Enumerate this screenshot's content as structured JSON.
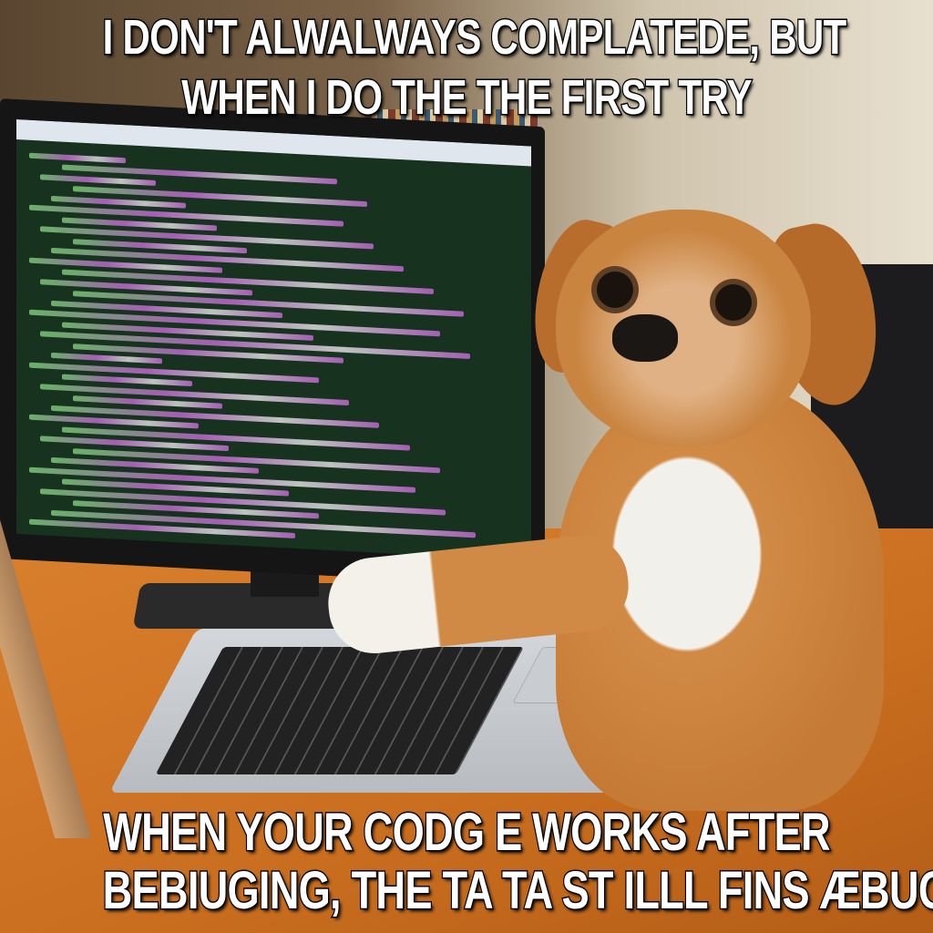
{
  "meme": {
    "top_text": [
      "I DON'T ALWALWAYS COMPLATEDE, BUT",
      "WHEN I DO THE THE FIRST TRY"
    ],
    "bottom_text": [
      "WHEN YOUR CODG E WORKS AFTER",
      "BEBIUGING, THE TA TA ST ILLL FINS ÆBUG"
    ]
  },
  "colors": {
    "desk": "#c96e1f",
    "screen": "#17321f",
    "dog": "#c98440"
  }
}
